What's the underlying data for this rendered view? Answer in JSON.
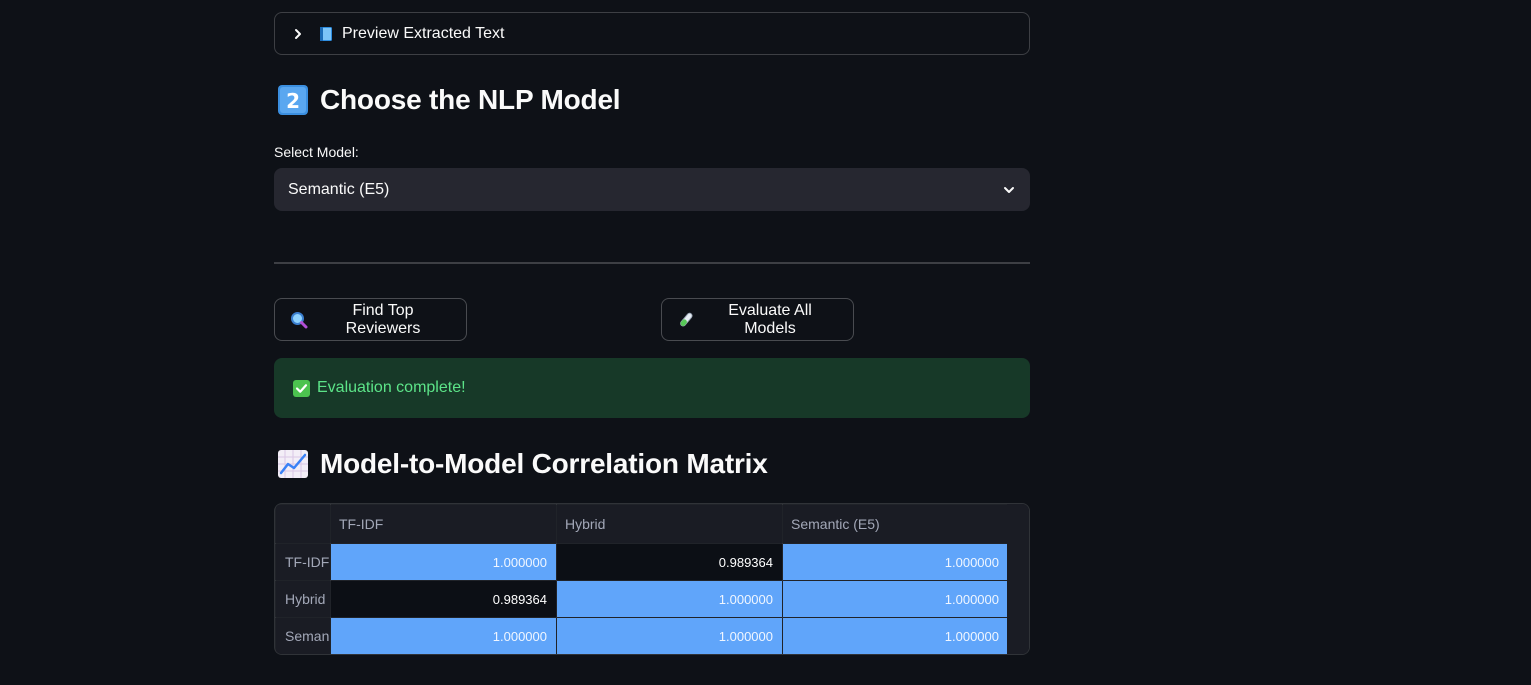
{
  "expander": {
    "label": "Preview Extracted Text",
    "icon": "book-icon"
  },
  "section_model": {
    "title": "Choose the NLP Model",
    "number_emoji": "2"
  },
  "model_select": {
    "label": "Select Model:",
    "value": "Semantic (E5)"
  },
  "buttons": {
    "find": {
      "label": "Find Top Reviewers",
      "icon": "magnifier-icon"
    },
    "evaluate": {
      "label": "Evaluate All Models",
      "icon": "test-tube-icon"
    }
  },
  "alert": {
    "message": "Evaluation complete!",
    "color": "#5ce488",
    "background": "#173928"
  },
  "section_matrix": {
    "title": "Model-to-Model Correlation Matrix",
    "icon": "chart-increasing-icon"
  },
  "matrix": {
    "columns": [
      "TF-IDF",
      "Hybrid",
      "Semantic (E5)"
    ],
    "rows": [
      {
        "label": "TF-IDF",
        "values": [
          "1.000000",
          "0.989364",
          "1.000000"
        ]
      },
      {
        "label": "Hybrid",
        "values": [
          "0.989364",
          "1.000000",
          "1.000000"
        ]
      },
      {
        "label": "Seman",
        "values": [
          "1.000000",
          "1.000000",
          "1.000000"
        ]
      }
    ],
    "highlight_color": "#60a5fa"
  }
}
